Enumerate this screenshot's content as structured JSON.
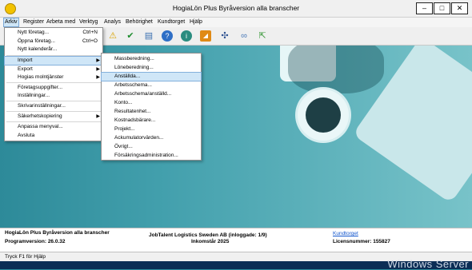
{
  "window": {
    "title": "HogiaLön Plus Byråversion alla branscher",
    "btn_min": "–",
    "btn_max": "□",
    "btn_close": "✕"
  },
  "menubar": {
    "items": [
      "Arkiv",
      "Register",
      "Arbeta med",
      "Verktyg",
      "Analys",
      "Behörighet",
      "Kundtorget",
      "Hjälp"
    ]
  },
  "toolbar": {
    "icons": [
      "warning-icon",
      "checkmark-icon",
      "document-icon",
      "help-icon",
      "info-icon",
      "rss-icon",
      "tools-icon",
      "link-icon",
      "export-icon"
    ]
  },
  "arkiv_menu": {
    "items": [
      {
        "label": "Nytt företag...",
        "shortcut": "Ctrl+N"
      },
      {
        "label": "Öppna företag...",
        "shortcut": "Ctrl+O"
      },
      {
        "label": "Nytt kalenderår..."
      },
      {
        "label": "Import",
        "arrow": "▶"
      },
      {
        "label": "Export",
        "arrow": "▶"
      },
      {
        "label": "Hogias molntjänster",
        "arrow": "▶"
      },
      {
        "label": "Företagsuppgifter..."
      },
      {
        "label": "Inställningar..."
      },
      {
        "label": "Skrivarinställningar..."
      },
      {
        "label": "Säkerhetskopiering",
        "arrow": "▶"
      },
      {
        "label": "Anpassa menyval..."
      },
      {
        "label": "Avsluta"
      }
    ]
  },
  "import_menu": {
    "items": [
      "Massberedning...",
      "Löneberedning...",
      "Anställda...",
      "Arbetsschema...",
      "Arbetsschema/anställd...",
      "Konto...",
      "Resultatenhet...",
      "Kostnadsbärare...",
      "Projekt...",
      "Ackumulatorvärden...",
      "Övrigt...",
      "Försäkringsadministration..."
    ]
  },
  "info": {
    "product": "HogiaLön Plus Byråversion alla branscher",
    "version": "Programversion: 26.0.32",
    "company": "JobTalent Logistics Sweden AB (inloggade: 1/9)",
    "year": "Inkomstår 2025",
    "kundtorget": "Kundtorget",
    "license": "Licensnummer: 155827"
  },
  "statusbar": {
    "text": "Tryck F1 för Hjälp"
  },
  "watermark": {
    "text": "Windows Server"
  }
}
